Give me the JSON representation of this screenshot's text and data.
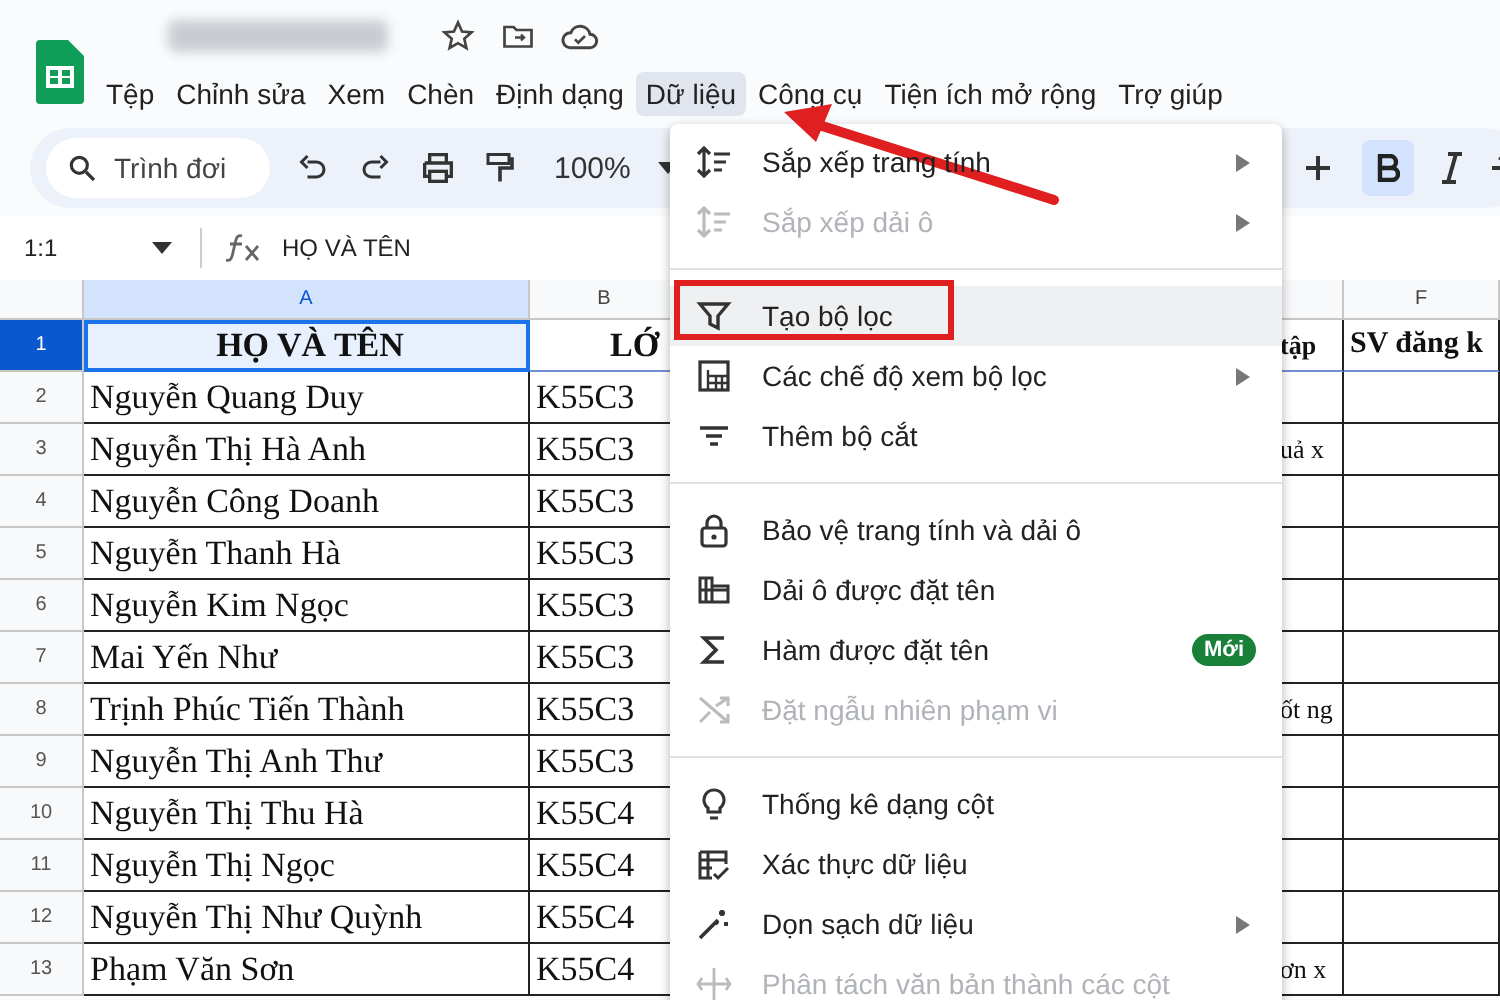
{
  "menubar": [
    {
      "label": "Tệp",
      "selected": false
    },
    {
      "label": "Chỉnh sửa",
      "selected": false
    },
    {
      "label": "Xem",
      "selected": false
    },
    {
      "label": "Chèn",
      "selected": false
    },
    {
      "label": "Định dạng",
      "selected": false
    },
    {
      "label": "Dữ liệu",
      "selected": true
    },
    {
      "label": "Công cụ",
      "selected": false
    },
    {
      "label": "Tiện ích mở rộng",
      "selected": false
    },
    {
      "label": "Trợ giúp",
      "selected": false
    }
  ],
  "toolbar": {
    "search_placeholder": "Trình đơi",
    "zoom": "100%",
    "bold_on": true
  },
  "formula_bar": {
    "cell_ref": "1:1",
    "content": "HỌ VÀ TÊN"
  },
  "columns": [
    {
      "label": "A",
      "selected": true
    },
    {
      "label": "B",
      "selected": false
    },
    {
      "label": "F",
      "selected": false
    }
  ],
  "rows": [
    {
      "number": "1",
      "selected": true,
      "cells": {
        "a": "HỌ VÀ TÊN",
        "b": "LỚ",
        "e": "tập",
        "f": "SV đăng k"
      }
    },
    {
      "number": "2",
      "selected": false,
      "cells": {
        "a": "Nguyễn Quang Duy",
        "b": "K55C3"
      }
    },
    {
      "number": "3",
      "selected": false,
      "cells": {
        "a": "Nguyễn Thị Hà Anh",
        "b": "K55C3",
        "e": "uả x"
      }
    },
    {
      "number": "4",
      "selected": false,
      "cells": {
        "a": "Nguyễn Công Doanh",
        "b": "K55C3"
      }
    },
    {
      "number": "5",
      "selected": false,
      "cells": {
        "a": "Nguyễn Thanh Hà",
        "b": "K55C3"
      }
    },
    {
      "number": "6",
      "selected": false,
      "cells": {
        "a": "Nguyễn Kim Ngọc",
        "b": "K55C3"
      }
    },
    {
      "number": "7",
      "selected": false,
      "cells": {
        "a": "Mai Yến Như",
        "b": "K55C3"
      }
    },
    {
      "number": "8",
      "selected": false,
      "cells": {
        "a": "Trịnh Phúc Tiến Thành",
        "b": "K55C3",
        "e": "ốt ng"
      }
    },
    {
      "number": "9",
      "selected": false,
      "cells": {
        "a": "Nguyễn Thị Anh Thư",
        "b": "K55C3"
      }
    },
    {
      "number": "10",
      "selected": false,
      "cells": {
        "a": "Nguyễn Thị Thu Hà",
        "b": "K55C4"
      }
    },
    {
      "number": "11",
      "selected": false,
      "cells": {
        "a": "Nguyễn Thị Ngọc",
        "b": "K55C4"
      }
    },
    {
      "number": "12",
      "selected": false,
      "cells": {
        "a": "Nguyễn Thị Như Quỳnh",
        "b": "K55C4"
      }
    },
    {
      "number": "13",
      "selected": false,
      "cells": {
        "a": "Phạm Văn Sơn",
        "b": "K55C4",
        "e": "ơn x"
      }
    }
  ],
  "data_menu": [
    {
      "kind": "item",
      "label": "Sắp xếp trang tính",
      "disabled": false,
      "submenu": true,
      "hovered": false,
      "boxed": false
    },
    {
      "kind": "item",
      "label": "Sắp xếp dải ô",
      "disabled": true,
      "submenu": true,
      "hovered": false,
      "boxed": false
    },
    {
      "kind": "divider"
    },
    {
      "kind": "item",
      "label": "Tạo bộ lọc",
      "disabled": false,
      "submenu": false,
      "hovered": true,
      "boxed": true
    },
    {
      "kind": "item",
      "label": "Các chế độ xem bộ lọc",
      "disabled": false,
      "submenu": true,
      "hovered": false,
      "boxed": false
    },
    {
      "kind": "item",
      "label": "Thêm bộ cắt",
      "disabled": false,
      "submenu": false,
      "hovered": false,
      "boxed": false
    },
    {
      "kind": "divider"
    },
    {
      "kind": "item",
      "label": "Bảo vệ trang tính và dải ô",
      "disabled": false,
      "submenu": false,
      "hovered": false,
      "boxed": false
    },
    {
      "kind": "item",
      "label": "Dải ô được đặt tên",
      "disabled": false,
      "submenu": false,
      "hovered": false,
      "boxed": false
    },
    {
      "kind": "item",
      "label": "Hàm được đặt tên",
      "disabled": false,
      "submenu": false,
      "hovered": false,
      "boxed": false,
      "badge": "Mới"
    },
    {
      "kind": "item",
      "label": "Đặt ngẫu nhiên phạm vi",
      "disabled": true,
      "submenu": false,
      "hovered": false,
      "boxed": false
    },
    {
      "kind": "divider"
    },
    {
      "kind": "item",
      "label": "Thống kê dạng cột",
      "disabled": false,
      "submenu": false,
      "hovered": false,
      "boxed": false
    },
    {
      "kind": "item",
      "label": "Xác thực dữ liệu",
      "disabled": false,
      "submenu": false,
      "hovered": false,
      "boxed": false
    },
    {
      "kind": "item",
      "label": "Dọn sạch dữ liệu",
      "disabled": false,
      "submenu": true,
      "hovered": false,
      "boxed": false
    },
    {
      "kind": "item",
      "label": "Phân tách văn bản thành các cột",
      "disabled": true,
      "submenu": false,
      "hovered": false,
      "boxed": false
    }
  ],
  "callout_arrow": true
}
